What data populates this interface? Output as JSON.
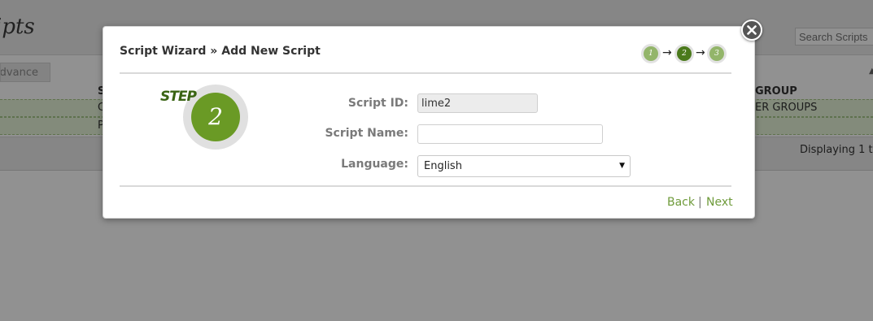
{
  "background": {
    "title": "ipts",
    "search_placeholder": "Search Scripts",
    "tab_label": "Advance",
    "columns": [
      "S",
      "GROUP"
    ],
    "rows": [
      {
        "first": "C",
        "group": "ER GROUPS"
      },
      {
        "first": "P",
        "group": ""
      }
    ],
    "footer_text": "Displaying 1 t"
  },
  "modal": {
    "title": "Script Wizard » Add New Script",
    "progress": {
      "steps": [
        "1",
        "2",
        "3"
      ],
      "current": 2
    },
    "step_label": "STEP",
    "step_number": "2",
    "fields": {
      "script_id": {
        "label": "Script ID:",
        "value": "lime2"
      },
      "script_name": {
        "label": "Script Name:",
        "value": ""
      },
      "language": {
        "label": "Language:",
        "value": "English"
      }
    },
    "back_label": "Back",
    "separator": "|",
    "next_label": "Next"
  },
  "icons": {
    "close": "close-icon",
    "dropdown": "caret-down-icon",
    "arrow": "arrow-right-icon"
  },
  "colors": {
    "accent": "#6a9a25",
    "accent_dark": "#4b7a1c",
    "link": "#6f9b3b"
  }
}
